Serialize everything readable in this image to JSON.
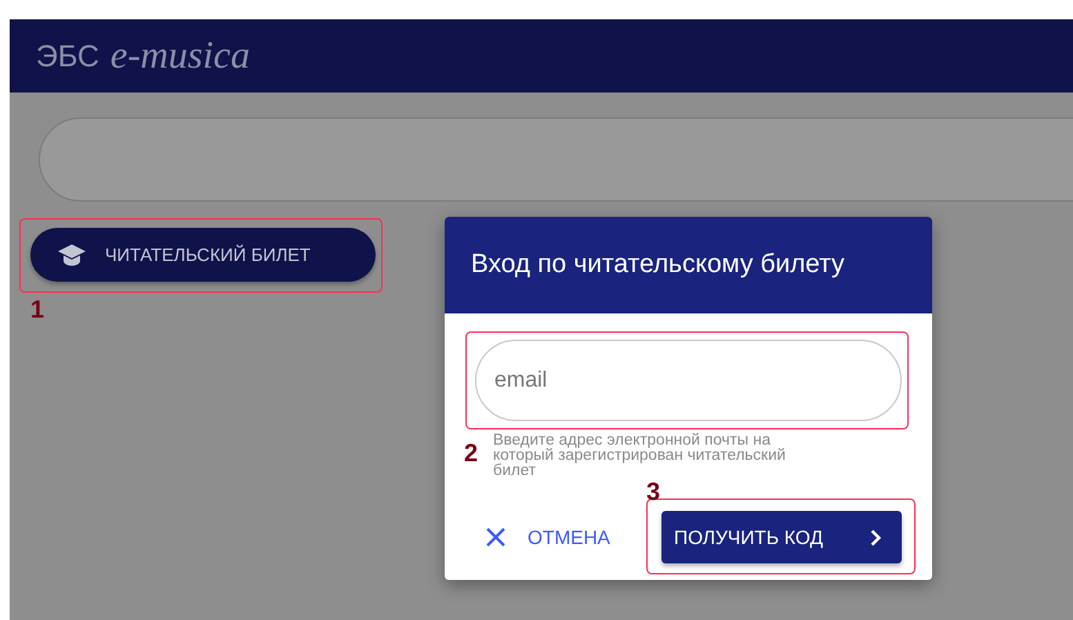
{
  "header": {
    "logo_prefix": "ЭБС",
    "logo_name": "e-musica"
  },
  "reader_card_button": {
    "label": "ЧИТАТЕЛЬСКИЙ БИЛЕТ",
    "annotation": "1"
  },
  "dialog": {
    "title": "Вход по читательскому билету",
    "email_field": {
      "placeholder": "email",
      "annotation": "2"
    },
    "helper_text": "Введите адрес электронной почты на который зарегистрирован читательский билет",
    "cancel_button": "ОТМЕНА",
    "submit_button": {
      "label": "ПОЛУЧИТЬ КОД",
      "annotation": "3"
    }
  }
}
